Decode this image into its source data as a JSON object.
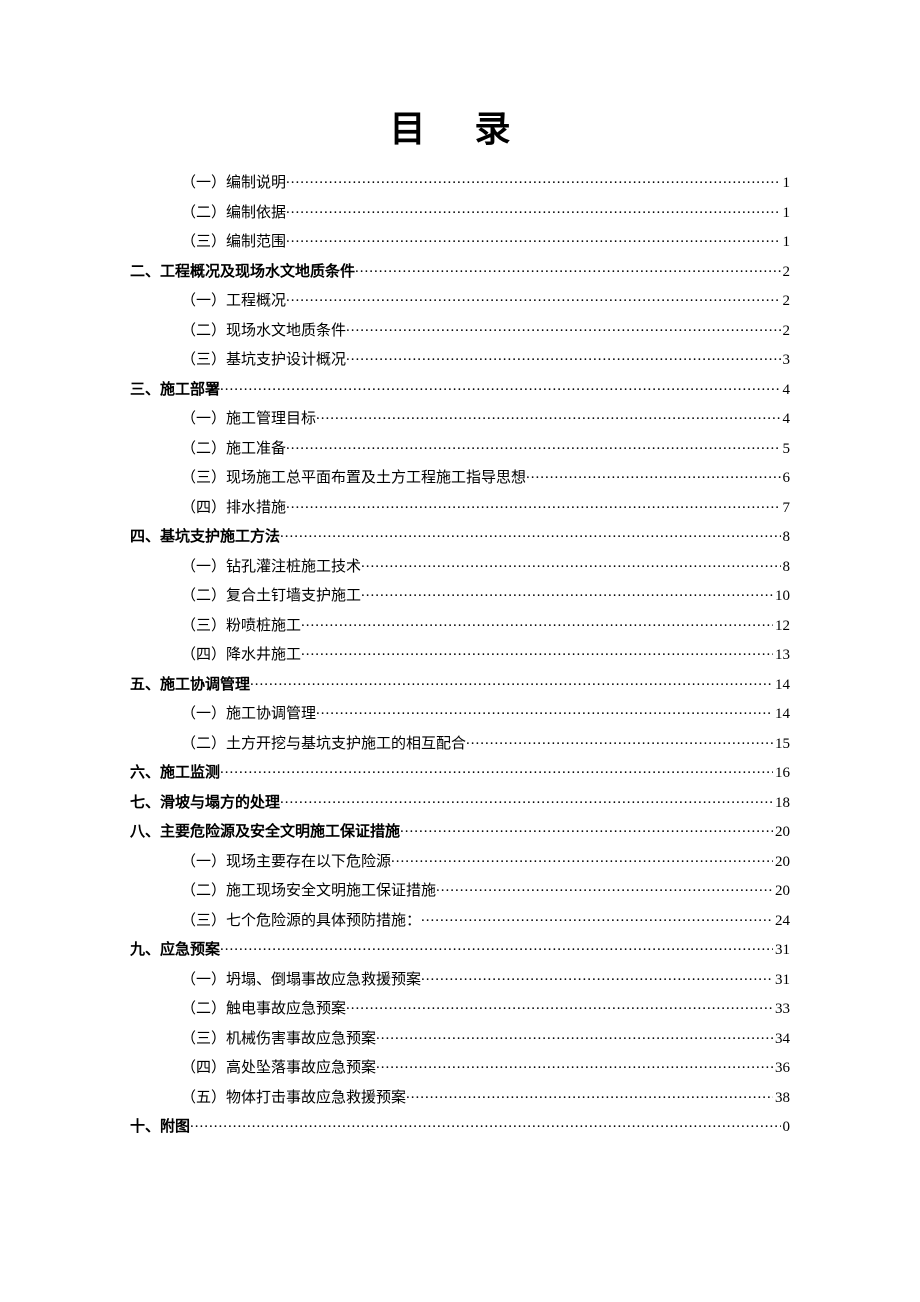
{
  "title": "目 录",
  "toc": [
    {
      "level": 1,
      "label": "（一）编制说明",
      "page": "1"
    },
    {
      "level": 1,
      "label": "（二）编制依据",
      "page": "1"
    },
    {
      "level": 1,
      "label": "（三）编制范围",
      "page": "1"
    },
    {
      "level": 0,
      "label": "二、工程概况及现场水文地质条件 ",
      "page": "2",
      "bold": true
    },
    {
      "level": 1,
      "label": "（一）工程概况",
      "page": "2"
    },
    {
      "level": 1,
      "label": "（二）现场水文地质条件",
      "page": "2"
    },
    {
      "level": 1,
      "label": "（三）基坑支护设计概况",
      "page": "3"
    },
    {
      "level": 0,
      "label": "三、施工部署 ",
      "page": "4",
      "bold": true
    },
    {
      "level": 1,
      "label": "（一）施工管理目标",
      "page": "4"
    },
    {
      "level": 1,
      "label": "（二）施工准备",
      "page": "5"
    },
    {
      "level": 1,
      "label": "（三）现场施工总平面布置及土方工程施工指导思想",
      "page": "6"
    },
    {
      "level": 1,
      "label": "（四）排水措施",
      "page": "7"
    },
    {
      "level": 0,
      "label": "四、基坑支护施工方法 ",
      "page": "8",
      "bold": true
    },
    {
      "level": 1,
      "label": "（一）钻孔灌注桩施工技术",
      "page": "8"
    },
    {
      "level": 1,
      "label": "（二）复合土钉墙支护施工",
      "page": "10"
    },
    {
      "level": 1,
      "label": "（三）粉喷桩施工",
      "page": "12"
    },
    {
      "level": 1,
      "label": "（四）降水井施工",
      "page": "13"
    },
    {
      "level": 0,
      "label": "五、施工协调管理 ",
      "page": "14",
      "bold": true
    },
    {
      "level": 1,
      "label": "（一）施工协调管理",
      "page": "14"
    },
    {
      "level": 1,
      "label": "（二）土方开挖与基坑支护施工的相互配合",
      "page": "15"
    },
    {
      "level": 0,
      "label": "六、施工监测 ",
      "page": "16",
      "bold": true
    },
    {
      "level": 0,
      "label": "七、滑坡与塌方的处理 ",
      "page": "18",
      "bold": true
    },
    {
      "level": 0,
      "label": "八、主要危险源及安全文明施工保证措施 ",
      "page": "20",
      "bold": true
    },
    {
      "level": 1,
      "label": "（一）现场主要存在以下危险源",
      "page": "20"
    },
    {
      "level": 1,
      "label": "（二）施工现场安全文明施工保证措施",
      "page": "20"
    },
    {
      "level": 1,
      "label": "（三）七个危险源的具体预防措施：",
      "page": "24"
    },
    {
      "level": 0,
      "label": "九、应急预案 ",
      "page": "31",
      "bold": true
    },
    {
      "level": 1,
      "label": "（一）坍塌、倒塌事故应急救援预案",
      "page": "31"
    },
    {
      "level": 1,
      "label": "（二）触电事故应急预案",
      "page": "33"
    },
    {
      "level": 1,
      "label": "（三）机械伤害事故应急预案",
      "page": "34"
    },
    {
      "level": 1,
      "label": "（四）高处坠落事故应急预案",
      "page": "36"
    },
    {
      "level": 1,
      "label": "（五）物体打击事故应急救援预案",
      "page": "38"
    },
    {
      "level": 0,
      "label": "十、附图 ",
      "page": "0",
      "bold": true
    }
  ]
}
